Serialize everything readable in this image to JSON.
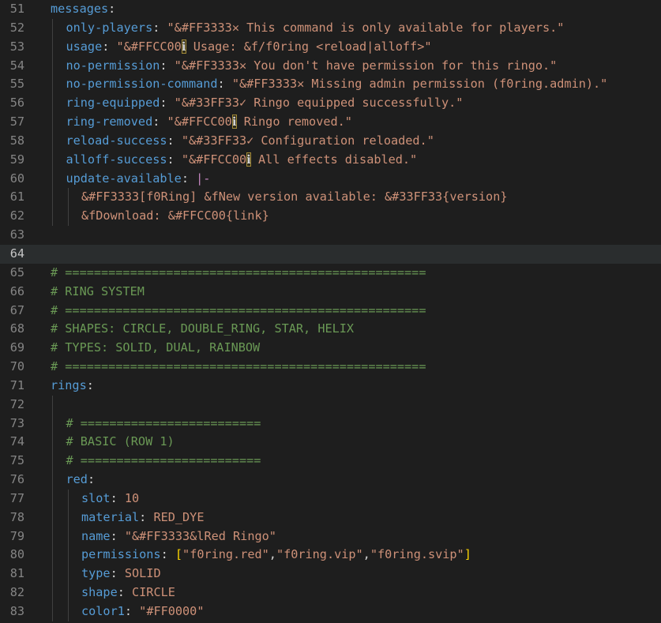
{
  "editor": {
    "current_line": 64,
    "lines": [
      {
        "n": "51",
        "indent": 0,
        "tokens": [
          {
            "t": "key",
            "v": "messages"
          },
          {
            "t": "plain",
            "v": ":"
          }
        ]
      },
      {
        "n": "52",
        "indent": 1,
        "tokens": [
          {
            "t": "key",
            "v": "only-players"
          },
          {
            "t": "plain",
            "v": ": "
          },
          {
            "t": "str",
            "v": "\"&#FF3333✕ This command is only available for players.\""
          }
        ]
      },
      {
        "n": "53",
        "indent": 1,
        "tokens": [
          {
            "t": "key",
            "v": "usage"
          },
          {
            "t": "plain",
            "v": ": "
          },
          {
            "t": "str",
            "v": "\"&#FFCC00"
          },
          {
            "t": "hl",
            "v": "ℹ"
          },
          {
            "t": "str",
            "v": " Usage: &f/f0ring <reload|alloff>\""
          }
        ]
      },
      {
        "n": "54",
        "indent": 1,
        "tokens": [
          {
            "t": "key",
            "v": "no-permission"
          },
          {
            "t": "plain",
            "v": ": "
          },
          {
            "t": "str",
            "v": "\"&#FF3333✕ You don't have permission for this ringo.\""
          }
        ]
      },
      {
        "n": "55",
        "indent": 1,
        "tokens": [
          {
            "t": "key",
            "v": "no-permission-command"
          },
          {
            "t": "plain",
            "v": ": "
          },
          {
            "t": "str",
            "v": "\"&#FF3333✕ Missing admin permission (f0ring.admin).\""
          }
        ]
      },
      {
        "n": "56",
        "indent": 1,
        "tokens": [
          {
            "t": "key",
            "v": "ring-equipped"
          },
          {
            "t": "plain",
            "v": ": "
          },
          {
            "t": "str",
            "v": "\"&#33FF33✓ Ringo equipped successfully.\""
          }
        ]
      },
      {
        "n": "57",
        "indent": 1,
        "tokens": [
          {
            "t": "key",
            "v": "ring-removed"
          },
          {
            "t": "plain",
            "v": ": "
          },
          {
            "t": "str",
            "v": "\"&#FFCC00"
          },
          {
            "t": "hl",
            "v": "ℹ"
          },
          {
            "t": "str",
            "v": " Ringo removed.\""
          }
        ]
      },
      {
        "n": "58",
        "indent": 1,
        "tokens": [
          {
            "t": "key",
            "v": "reload-success"
          },
          {
            "t": "plain",
            "v": ": "
          },
          {
            "t": "str",
            "v": "\"&#33FF33✓ Configuration reloaded.\""
          }
        ]
      },
      {
        "n": "59",
        "indent": 1,
        "tokens": [
          {
            "t": "key",
            "v": "alloff-success"
          },
          {
            "t": "plain",
            "v": ": "
          },
          {
            "t": "str",
            "v": "\"&#FFCC00"
          },
          {
            "t": "hl",
            "v": "ℹ"
          },
          {
            "t": "str",
            "v": " All effects disabled.\""
          }
        ]
      },
      {
        "n": "60",
        "indent": 1,
        "tokens": [
          {
            "t": "key",
            "v": "update-available"
          },
          {
            "t": "plain",
            "v": ": "
          },
          {
            "t": "pipe",
            "v": "|-"
          }
        ]
      },
      {
        "n": "61",
        "indent": 2,
        "tokens": [
          {
            "t": "str",
            "v": "&#FF3333[f0Ring] &fNew version available: &#33FF33{version}"
          }
        ]
      },
      {
        "n": "62",
        "indent": 2,
        "tokens": [
          {
            "t": "str",
            "v": "&fDownload: &#FFCC00{link}"
          }
        ]
      },
      {
        "n": "63",
        "indent": 0,
        "tokens": []
      },
      {
        "n": "64",
        "indent": 0,
        "tokens": []
      },
      {
        "n": "65",
        "indent": 0,
        "tokens": [
          {
            "t": "cmt",
            "v": "# =================================================="
          }
        ]
      },
      {
        "n": "66",
        "indent": 0,
        "tokens": [
          {
            "t": "cmt",
            "v": "# RING SYSTEM"
          }
        ]
      },
      {
        "n": "67",
        "indent": 0,
        "tokens": [
          {
            "t": "cmt",
            "v": "# =================================================="
          }
        ]
      },
      {
        "n": "68",
        "indent": 0,
        "tokens": [
          {
            "t": "cmt",
            "v": "# SHAPES: CIRCLE, DOUBLE_RING, STAR, HELIX"
          }
        ]
      },
      {
        "n": "69",
        "indent": 0,
        "tokens": [
          {
            "t": "cmt",
            "v": "# TYPES: SOLID, DUAL, RAINBOW"
          }
        ]
      },
      {
        "n": "70",
        "indent": 0,
        "tokens": [
          {
            "t": "cmt",
            "v": "# =================================================="
          }
        ]
      },
      {
        "n": "71",
        "indent": 0,
        "tokens": [
          {
            "t": "key",
            "v": "rings"
          },
          {
            "t": "plain",
            "v": ":"
          }
        ]
      },
      {
        "n": "72",
        "indent": 1,
        "tokens": []
      },
      {
        "n": "73",
        "indent": 1,
        "tokens": [
          {
            "t": "cmt",
            "v": "# ========================="
          }
        ]
      },
      {
        "n": "74",
        "indent": 1,
        "tokens": [
          {
            "t": "cmt",
            "v": "# BASIC (ROW 1)"
          }
        ]
      },
      {
        "n": "75",
        "indent": 1,
        "tokens": [
          {
            "t": "cmt",
            "v": "# ========================="
          }
        ]
      },
      {
        "n": "76",
        "indent": 1,
        "tokens": [
          {
            "t": "key",
            "v": "red"
          },
          {
            "t": "plain",
            "v": ":"
          }
        ]
      },
      {
        "n": "77",
        "indent": 2,
        "tokens": [
          {
            "t": "key",
            "v": "slot"
          },
          {
            "t": "plain",
            "v": ": "
          },
          {
            "t": "str",
            "v": "10"
          }
        ]
      },
      {
        "n": "78",
        "indent": 2,
        "tokens": [
          {
            "t": "key",
            "v": "material"
          },
          {
            "t": "plain",
            "v": ": "
          },
          {
            "t": "str",
            "v": "RED_DYE"
          }
        ]
      },
      {
        "n": "79",
        "indent": 2,
        "tokens": [
          {
            "t": "key",
            "v": "name"
          },
          {
            "t": "plain",
            "v": ": "
          },
          {
            "t": "str",
            "v": "\"&#FF3333&lRed Ringo\""
          }
        ]
      },
      {
        "n": "80",
        "indent": 2,
        "tokens": [
          {
            "t": "key",
            "v": "permissions"
          },
          {
            "t": "plain",
            "v": ": "
          },
          {
            "t": "bracket-gold",
            "v": "["
          },
          {
            "t": "str",
            "v": "\"f0ring.red\""
          },
          {
            "t": "plain",
            "v": ","
          },
          {
            "t": "str",
            "v": "\"f0ring.vip\""
          },
          {
            "t": "plain",
            "v": ","
          },
          {
            "t": "str",
            "v": "\"f0ring.svip\""
          },
          {
            "t": "bracket-gold",
            "v": "]"
          }
        ]
      },
      {
        "n": "81",
        "indent": 2,
        "tokens": [
          {
            "t": "key",
            "v": "type"
          },
          {
            "t": "plain",
            "v": ": "
          },
          {
            "t": "str",
            "v": "SOLID"
          }
        ]
      },
      {
        "n": "82",
        "indent": 2,
        "tokens": [
          {
            "t": "key",
            "v": "shape"
          },
          {
            "t": "plain",
            "v": ": "
          },
          {
            "t": "str",
            "v": "CIRCLE"
          }
        ]
      },
      {
        "n": "83",
        "indent": 2,
        "tokens": [
          {
            "t": "key",
            "v": "color1"
          },
          {
            "t": "plain",
            "v": ": "
          },
          {
            "t": "str",
            "v": "\"#FF0000\""
          }
        ]
      }
    ]
  }
}
